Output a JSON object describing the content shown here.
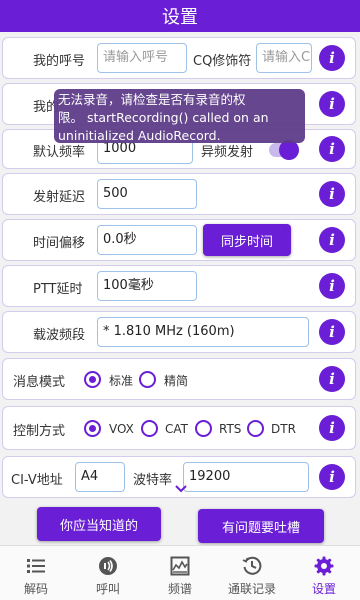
{
  "title": "设置",
  "colors": {
    "accent": "#6a1fd6",
    "field_border": "#9ec2e8",
    "toast_bg": "#5c3a87"
  },
  "rows": {
    "callsign": {
      "label": "我的呼号",
      "placeholder": "请输入呼号",
      "cq_label": "CQ修饰符",
      "cq_placeholder": "请输入C"
    },
    "grid": {
      "label": "我的"
    },
    "freq": {
      "label": "默认频率",
      "value": "1000",
      "tx_label": "异频发射",
      "tx_on": true
    },
    "delay": {
      "label": "发射延迟",
      "value": "500"
    },
    "offset": {
      "label": "时间偏移",
      "value": "0.0秒",
      "sync_button": "同步时间"
    },
    "ptt": {
      "label": "PTT延时",
      "value": "100毫秒"
    },
    "band": {
      "label": "载波频段",
      "value": "* 1.810 MHz (160m)"
    },
    "msg_mode": {
      "label": "消息模式",
      "options": [
        "标准",
        "精简"
      ],
      "selected": 0
    },
    "control": {
      "label": "控制方式",
      "options": [
        "VOX",
        "CAT",
        "RTS",
        "DTR"
      ],
      "selected": 0
    },
    "civ": {
      "label": "CI-V地址",
      "value": "A4",
      "baud_label": "波特率",
      "baud_value": "19200"
    }
  },
  "info_icon_glyph": "i",
  "buttons": {
    "know": "你应当知道的",
    "complain": "有问题要吐槽"
  },
  "toast": {
    "line1": "无法录音，请检查是否有录音的权",
    "line2": "限。 startRecording() called on an",
    "line3": "uninitialized AudioRecord."
  },
  "nav": [
    {
      "label": "解码",
      "icon": "list-icon"
    },
    {
      "label": "呼叫",
      "icon": "call-icon"
    },
    {
      "label": "频谱",
      "icon": "spectrum-icon"
    },
    {
      "label": "通联记录",
      "icon": "history-icon"
    },
    {
      "label": "设置",
      "icon": "gear-icon",
      "active": true
    }
  ]
}
